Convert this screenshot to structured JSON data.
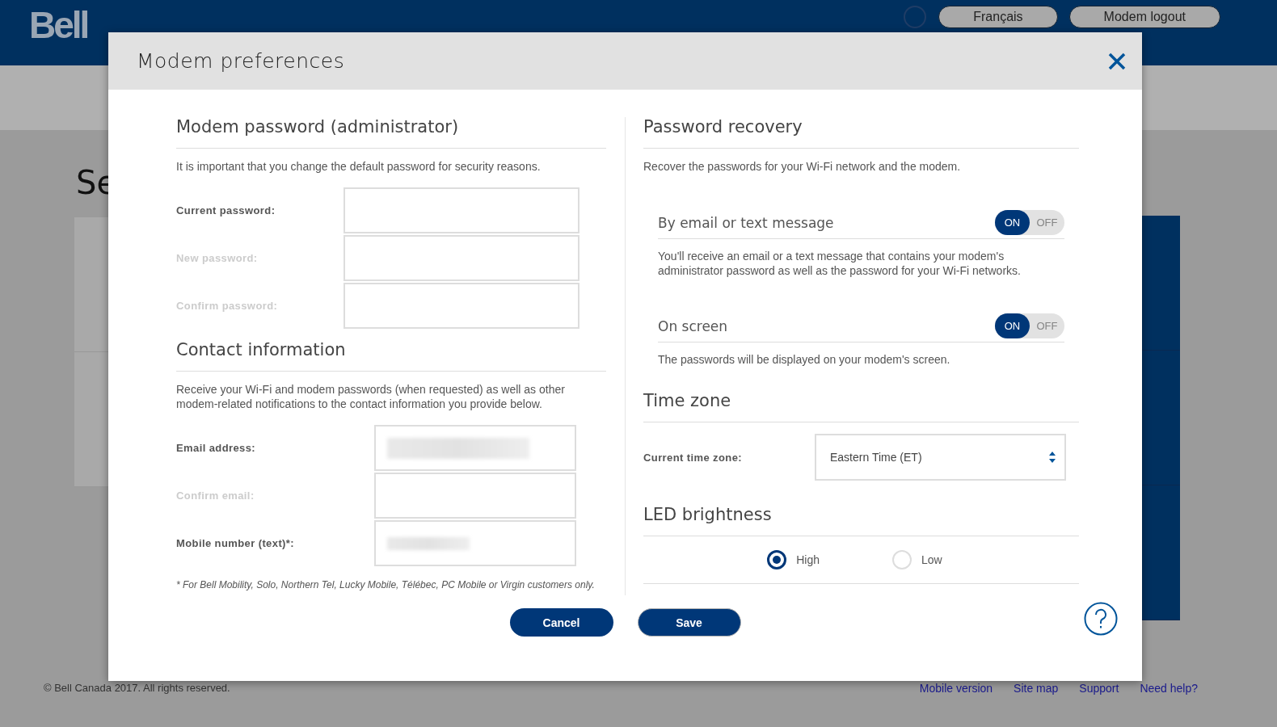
{
  "header": {
    "logo": "Bell",
    "buttons": [
      "Français",
      "Modem logout"
    ]
  },
  "page": {
    "title": "Se"
  },
  "modal": {
    "title": "Modem preferences",
    "password": {
      "heading": "Modem password (administrator)",
      "intro": "It is important that you change the default password for security reasons.",
      "fields": [
        {
          "label": "Current password:",
          "disabled": false,
          "redacted": false
        },
        {
          "label": "New password:",
          "disabled": true,
          "redacted": false
        },
        {
          "label": "Confirm password:",
          "disabled": true,
          "redacted": false
        }
      ]
    },
    "contact": {
      "heading": "Contact information",
      "intro": "Receive your Wi-Fi and modem passwords (when requested) as well as other modem-related notifications to the contact information you provide below.",
      "fields": [
        {
          "label": "Email address:",
          "disabled": false,
          "redacted": true
        },
        {
          "label": "Confirm email:",
          "disabled": true,
          "redacted": false
        },
        {
          "label": "Mobile number (text)*:",
          "disabled": false,
          "redacted": true
        }
      ],
      "footnote": "* For Bell Mobility, Solo, Northern Tel, Lucky Mobile, Télébec, PC Mobile or Virgin customers only."
    },
    "recovery": {
      "heading": "Password recovery",
      "intro": "Recover the passwords for your Wi-Fi network and the modem.",
      "options": [
        {
          "title": "By email or text message",
          "on": true,
          "on_label": "ON",
          "off_label": "OFF",
          "description": "You'll receive an email or a text message that contains your modem's administrator password as well as the password for your Wi-Fi networks."
        },
        {
          "title": "On screen",
          "on": true,
          "on_label": "ON",
          "off_label": "OFF",
          "description": "The passwords will be displayed on your modem's screen."
        }
      ]
    },
    "timezone": {
      "heading": "Time zone",
      "label": "Current time zone:",
      "value": "Eastern Time (ET)"
    },
    "led": {
      "heading": "LED brightness",
      "options": [
        {
          "label": "High",
          "selected": true
        },
        {
          "label": "Low",
          "selected": false
        }
      ]
    },
    "buttons": [
      "Cancel",
      "Save"
    ]
  },
  "footer": {
    "copyright": "© Bell Canada 2017. All rights reserved.",
    "links": [
      "Mobile version",
      "Site map",
      "Support",
      "Need help?"
    ]
  }
}
